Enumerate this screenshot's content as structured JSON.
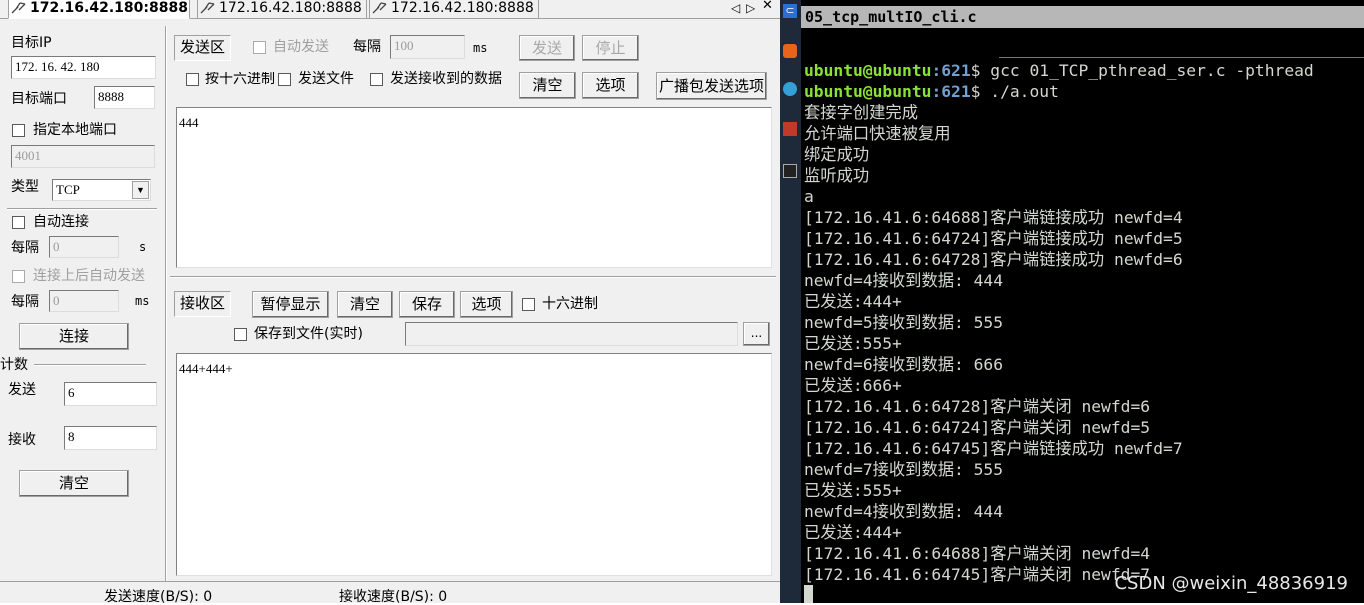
{
  "tabs": [
    "172.16.42.180:8888",
    "172.16.42.180:8888",
    "172.16.42.180:8888"
  ],
  "tab_controls": {
    "left": "◁",
    "right": "▷",
    "close": "✕"
  },
  "left": {
    "target_ip_label": "目标IP",
    "target_ip_value": "172. 16. 42. 180",
    "target_port_label": "目标端口",
    "target_port_value": "8888",
    "local_port_label": "指定本地端口",
    "local_port_value": "4001",
    "type_label": "类型",
    "type_value": "TCP",
    "auto_connect_label": "自动连接",
    "interval_label": "每隔",
    "interval_value": "0",
    "interval_unit": "s",
    "auto_send_after_label": "连接上后自动发送",
    "interval2_label": "每隔",
    "interval2_value": "0",
    "interval2_unit": "ms",
    "connect_button": "连接",
    "count_label": "计数",
    "send_label": "发送",
    "send_value": "6",
    "recv_label": "接收",
    "recv_value": "8",
    "clear_button": "清空"
  },
  "send": {
    "title": "发送区",
    "auto_send": "自动发送",
    "interval_label": "每隔",
    "interval_value": "100",
    "interval_unit": "ms",
    "send_button": "发送",
    "stop_button": "停止",
    "hex_send": "按十六进制",
    "send_file": "发送文件",
    "send_received": "发送接收到的数据",
    "clear_button": "清空",
    "options_button": "选项",
    "broadcast_button": "广播包发送选项",
    "content": "444"
  },
  "recv": {
    "title": "接收区",
    "pause_button": "暂停显示",
    "clear_button": "清空",
    "save_button": "保存",
    "options_button": "选项",
    "hex_label": "十六进制",
    "save_to_file": "保存到文件(实时)",
    "browse_button": "...",
    "content": "444+444+"
  },
  "status": {
    "send_speed": "发送速度(B/S): 0",
    "recv_speed": "接收速度(B/S): 0"
  },
  "terminal": {
    "title": "05_tcp_multIO_cli.c",
    "user": "ubuntu@ubuntu",
    "path": ":621",
    "cmd1": "$ gcc 01_TCP_pthread_ser.c -pthread",
    "cmd2": "$ ./a.out",
    "lines": [
      "套接字创建完成",
      "允许端口快速被复用",
      "绑定成功",
      "监听成功",
      "a",
      "[172.16.41.6:64688]客户端链接成功 newfd=4",
      "[172.16.41.6:64724]客户端链接成功 newfd=5",
      "[172.16.41.6:64728]客户端链接成功 newfd=6",
      "newfd=4接收到数据: 444",
      "已发送:444+",
      "newfd=5接收到数据: 555",
      "已发送:555+",
      "newfd=6接收到数据: 666",
      "已发送:666+",
      "[172.16.41.6:64728]客户端关闭 newfd=6",
      "[172.16.41.6:64724]客户端关闭 newfd=5",
      "[172.16.41.6:64745]客户端链接成功 newfd=7",
      "newfd=7接收到数据: 555",
      "已发送:555+",
      "newfd=4接收到数据: 444",
      "已发送:444+",
      "[172.16.41.6:64688]客户端关闭 newfd=4",
      "[172.16.41.6:64745]客户端关闭 newfd=7"
    ],
    "watermark": "CSDN @weixin_48836919"
  }
}
